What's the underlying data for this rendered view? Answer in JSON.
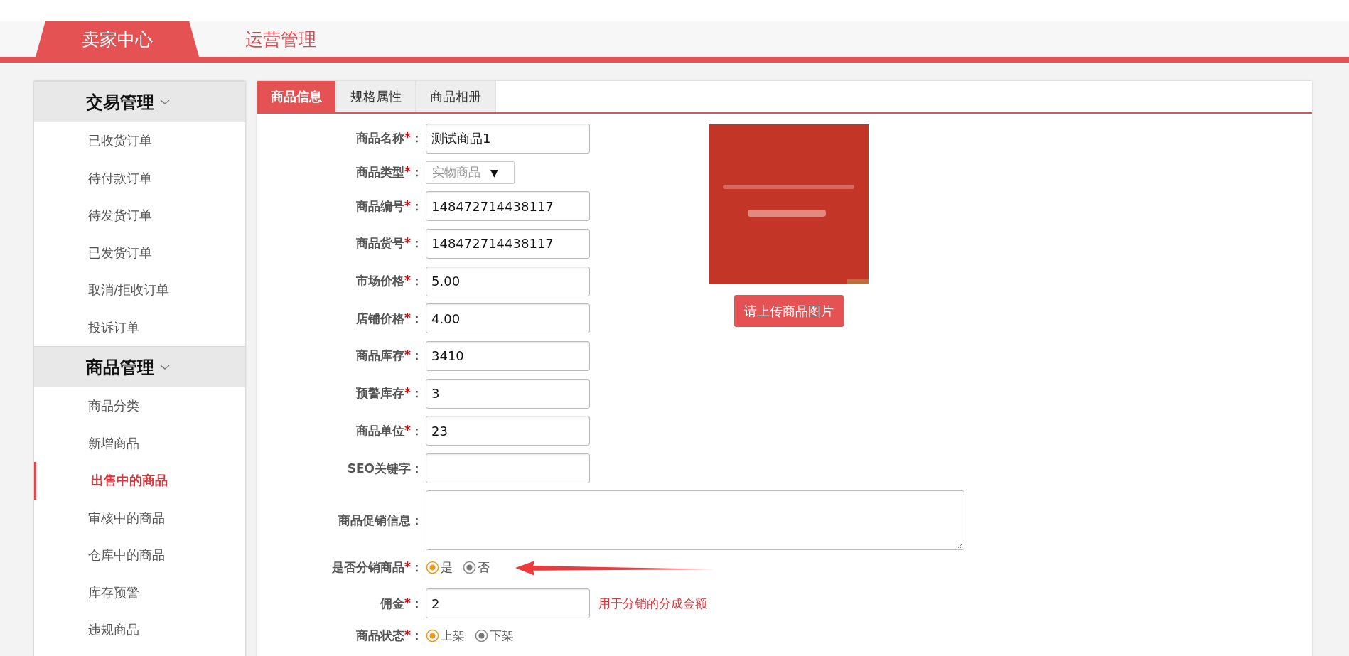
{
  "top_tabs": [
    {
      "label": "卖家中心",
      "selected": true
    },
    {
      "label": "运营管理",
      "selected": false
    }
  ],
  "sidebar": [
    {
      "title": "交易管理",
      "expanded": true,
      "items": [
        {
          "label": "已收货订单",
          "selected": false
        },
        {
          "label": "待付款订单",
          "selected": false
        },
        {
          "label": "待发货订单",
          "selected": false
        },
        {
          "label": "已发货订单",
          "selected": false
        },
        {
          "label": "取消/拒收订单",
          "selected": false
        },
        {
          "label": "投诉订单",
          "selected": false
        }
      ]
    },
    {
      "title": "商品管理",
      "expanded": true,
      "items": [
        {
          "label": "商品分类",
          "selected": false
        },
        {
          "label": "新增商品",
          "selected": false
        },
        {
          "label": "出售中的商品",
          "selected": true
        },
        {
          "label": "审核中的商品",
          "selected": false
        },
        {
          "label": "仓库中的商品",
          "selected": false
        },
        {
          "label": "库存预警",
          "selected": false
        },
        {
          "label": "违规商品",
          "selected": false
        }
      ]
    }
  ],
  "tabs": [
    {
      "label": "商品信息",
      "selected": true
    },
    {
      "label": "规格属性",
      "selected": false
    },
    {
      "label": "商品相册",
      "selected": false
    }
  ],
  "form": [
    {
      "kind": "input",
      "label": "商品名称",
      "required": true,
      "value": "测试商品1"
    },
    {
      "kind": "select",
      "label": "商品类型",
      "required": true,
      "value": "实物商品",
      "arrow": "▼",
      "disabled": true
    },
    {
      "kind": "input",
      "label": "商品编号",
      "required": true,
      "value": "148472714438117"
    },
    {
      "kind": "input",
      "label": "商品货号",
      "required": true,
      "value": "148472714438117"
    },
    {
      "kind": "input",
      "label": "市场价格",
      "required": true,
      "value": "5.00"
    },
    {
      "kind": "input",
      "label": "店铺价格",
      "required": true,
      "value": "4.00"
    },
    {
      "kind": "input",
      "label": "商品库存",
      "required": true,
      "value": "3410"
    },
    {
      "kind": "input",
      "label": "预警库存",
      "required": true,
      "value": "3"
    },
    {
      "kind": "input",
      "label": "商品单位",
      "required": true,
      "value": "23"
    },
    {
      "kind": "input",
      "label": "SEO关键字",
      "required": false
    },
    {
      "kind": "textarea",
      "label": "商品促销信息",
      "required": false
    },
    {
      "kind": "radio",
      "label": "是否分销商品",
      "required": true,
      "annotated": true,
      "options": [
        {
          "label": "是",
          "selected": true
        },
        {
          "label": "否",
          "selected": false
        }
      ]
    },
    {
      "kind": "input",
      "label": "佣金",
      "required": true,
      "value": "2",
      "note": "用于分销的分成金额"
    },
    {
      "kind": "radio",
      "label": "商品状态",
      "required": true,
      "options": [
        {
          "label": "上架",
          "selected": true
        },
        {
          "label": "下架",
          "selected": false
        }
      ]
    }
  ],
  "upload_button": "请上传商品图片",
  "required_mark": "*",
  "colon": "："
}
